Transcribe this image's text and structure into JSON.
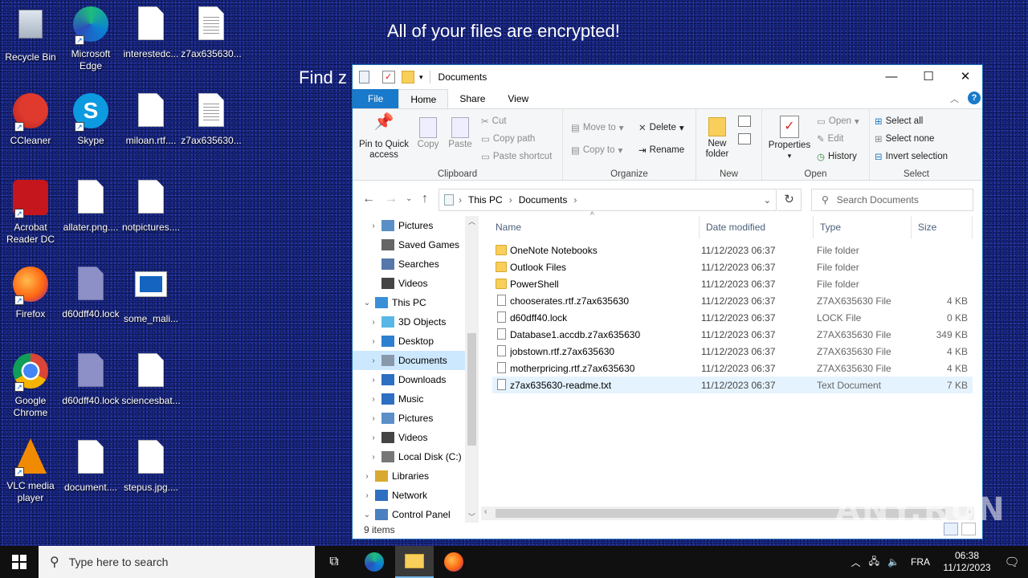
{
  "desktop": {
    "wallpaper_lines": [
      "All of your files are encrypted!",
      "Find z"
    ],
    "icons": [
      {
        "label": "Recycle Bin"
      },
      {
        "label": "Microsoft Edge"
      },
      {
        "label": "interestedc..."
      },
      {
        "label": "z7ax635630..."
      },
      {
        "label": "CCleaner"
      },
      {
        "label": "Skype"
      },
      {
        "label": "miloan.rtf...."
      },
      {
        "label": "z7ax635630..."
      },
      {
        "label": "Acrobat Reader DC"
      },
      {
        "label": "allater.png...."
      },
      {
        "label": "notpictures...."
      },
      {
        "label": "Firefox"
      },
      {
        "label": "d60dff40.lock"
      },
      {
        "label": "some_mali..."
      },
      {
        "label": "Google Chrome"
      },
      {
        "label": "d60dff40.lock"
      },
      {
        "label": "sciencesbat..."
      },
      {
        "label": "VLC media player"
      },
      {
        "label": "document...."
      },
      {
        "label": "stepus.jpg...."
      }
    ]
  },
  "explorer": {
    "title": "Documents",
    "window_buttons": {
      "minimize": "—",
      "maximize": "☐",
      "close": "✕"
    },
    "ribbon_tabs": [
      "File",
      "Home",
      "Share",
      "View"
    ],
    "ribbon": {
      "clipboard": {
        "pin": "Pin to Quick access",
        "copy": "Copy",
        "paste": "Paste",
        "cut": "Cut",
        "copy_path": "Copy path",
        "paste_shortcut": "Paste shortcut",
        "group": "Clipboard"
      },
      "organize": {
        "move_to": "Move to",
        "copy_to": "Copy to",
        "delete": "Delete",
        "rename": "Rename",
        "group": "Organize"
      },
      "new": {
        "new_folder": "New folder",
        "group": "New"
      },
      "open": {
        "properties": "Properties",
        "open": "Open",
        "edit": "Edit",
        "history": "History",
        "group": "Open"
      },
      "select": {
        "select_all": "Select all",
        "select_none": "Select none",
        "invert": "Invert selection",
        "group": "Select"
      }
    },
    "address": {
      "crumbs": [
        "This PC",
        "Documents"
      ],
      "search_placeholder": "Search Documents"
    },
    "nav_items": [
      {
        "label": "Pictures",
        "chev": "›",
        "indent": 1
      },
      {
        "label": "Saved Games",
        "chev": "",
        "indent": 1
      },
      {
        "label": "Searches",
        "chev": "",
        "indent": 1
      },
      {
        "label": "Videos",
        "chev": "",
        "indent": 1
      },
      {
        "label": "This PC",
        "chev": "⌄",
        "indent": 0
      },
      {
        "label": "3D Objects",
        "chev": "›",
        "indent": 1
      },
      {
        "label": "Desktop",
        "chev": "›",
        "indent": 1
      },
      {
        "label": "Documents",
        "chev": "›",
        "indent": 1,
        "selected": true
      },
      {
        "label": "Downloads",
        "chev": "›",
        "indent": 1
      },
      {
        "label": "Music",
        "chev": "›",
        "indent": 1
      },
      {
        "label": "Pictures",
        "chev": "›",
        "indent": 1
      },
      {
        "label": "Videos",
        "chev": "›",
        "indent": 1
      },
      {
        "label": "Local Disk (C:)",
        "chev": "›",
        "indent": 1
      },
      {
        "label": "Libraries",
        "chev": "›",
        "indent": 0
      },
      {
        "label": "Network",
        "chev": "›",
        "indent": 0
      },
      {
        "label": "Control Panel",
        "chev": "⌄",
        "indent": 0
      }
    ],
    "columns": {
      "name": "Name",
      "date": "Date modified",
      "type": "Type",
      "size": "Size"
    },
    "files": [
      {
        "name": "OneNote Notebooks",
        "date": "11/12/2023 06:37",
        "type": "File folder",
        "size": "",
        "kind": "folder"
      },
      {
        "name": "Outlook Files",
        "date": "11/12/2023 06:37",
        "type": "File folder",
        "size": "",
        "kind": "folder"
      },
      {
        "name": "PowerShell",
        "date": "11/12/2023 06:37",
        "type": "File folder",
        "size": "",
        "kind": "folder"
      },
      {
        "name": "chooserates.rtf.z7ax635630",
        "date": "11/12/2023 06:37",
        "type": "Z7AX635630 File",
        "size": "4 KB",
        "kind": "file"
      },
      {
        "name": "d60dff40.lock",
        "date": "11/12/2023 06:37",
        "type": "LOCK File",
        "size": "0 KB",
        "kind": "file"
      },
      {
        "name": "Database1.accdb.z7ax635630",
        "date": "11/12/2023 06:37",
        "type": "Z7AX635630 File",
        "size": "349 KB",
        "kind": "file"
      },
      {
        "name": "jobstown.rtf.z7ax635630",
        "date": "11/12/2023 06:37",
        "type": "Z7AX635630 File",
        "size": "4 KB",
        "kind": "file"
      },
      {
        "name": "motherpricing.rtf.z7ax635630",
        "date": "11/12/2023 06:37",
        "type": "Z7AX635630 File",
        "size": "4 KB",
        "kind": "file"
      },
      {
        "name": "z7ax635630-readme.txt",
        "date": "11/12/2023 06:37",
        "type": "Text Document",
        "size": "7 KB",
        "kind": "file",
        "selected": true
      }
    ],
    "status": "9 items"
  },
  "taskbar": {
    "search_placeholder": "Type here to search",
    "language": "FRA",
    "time": "06:38",
    "date": "11/12/2023"
  },
  "watermark": "ANY.RUN"
}
